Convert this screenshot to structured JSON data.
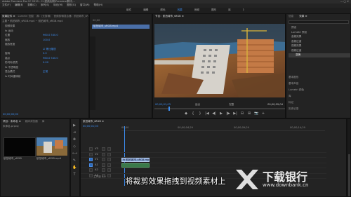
{
  "window": {
    "title": "Adobe Premiere Pro CC 2019 - C:\\视频后期\\Premiere素材\\...",
    "menu": [
      "文件(F)",
      "编辑(E)",
      "剪辑(C)",
      "序列(S)",
      "标记(M)",
      "图形(G)",
      "窗口(W)",
      "帮助(H)"
    ]
  },
  "workspace_tabs": [
    "组件",
    "编辑",
    "颜色",
    "效果",
    "音频",
    "图形",
    "库",
    "》"
  ],
  "effect_controls": {
    "tabs": [
      "效果控件 ≡",
      "Lumetri 范围",
      "源：(无剪辑)",
      "音频剪辑混合器：航拍城市_sRGB"
    ],
    "clip_path": "主要 * 航拍城市_sRGB.mp4 ~ 航拍城市_sRGB.mp4",
    "rows": [
      {
        "label": "视频效果",
        "value": ""
      },
      {
        "label": "fx 运动",
        "value": ""
      },
      {
        "label": "位置",
        "value": "960.0   540.0"
      },
      {
        "label": "缩放",
        "value": "100.0"
      },
      {
        "label": "缩放宽度",
        "value": ""
      },
      {
        "label": "",
        "value": "☑ 等比缩放"
      },
      {
        "label": "旋转",
        "value": "0.0"
      },
      {
        "label": "锚点",
        "value": "960.0   540.0"
      },
      {
        "label": "防闪烁滤镜",
        "value": "0.00"
      },
      {
        "label": "fx 不透明度",
        "value": ""
      },
      {
        "label": "混合模式",
        "value": "正常"
      },
      {
        "label": "fx 时间重映射",
        "value": ""
      }
    ],
    "timecode": "00;00;00;00"
  },
  "source_strip": {
    "ruler": "00;00",
    "clip_label": "航拍城市_sRGB.mp4"
  },
  "program_monitor": {
    "tab": "节目：航拍城市_sRGB ≡",
    "timecode_left": "00;00;01;03",
    "fit": "适合",
    "quality": "完整",
    "timecode_right": "00;00;09;04",
    "transport": [
      "◆",
      "{",
      "}",
      "|◀",
      "◀|",
      "▶",
      "|▶",
      "▶|",
      "⊟",
      "⊞",
      "📷",
      "+"
    ]
  },
  "effects_panel": {
    "tabs": [
      "信息",
      "效果 ≡"
    ],
    "search_placeholder": "",
    "items": [
      "预设",
      "Lumetri 预设",
      "音频效果",
      "音频过渡",
      "视频效果",
      "视频过渡"
    ],
    "selected_item": "变换",
    "sub_items": [
      "变换"
    ],
    "other_panels": [
      "基本图形",
      "基本声音",
      "Lumetri 颜色",
      "库",
      "标记",
      "历史记录"
    ]
  },
  "project_panel": {
    "tabs": [
      "项目：未命名 ≡",
      "媒体浏览器",
      "库"
    ],
    "title": "未命名.prproj",
    "clips": [
      {
        "name": "航拍城市_sRGB",
        "duration": "9;04"
      },
      {
        "name": "航拍城市_sRGB.mp4",
        "duration": "9;04"
      }
    ]
  },
  "timeline": {
    "tab": "航拍城市_sRGB ≡",
    "timecode": "00;00;01;03",
    "ruler": [
      "00;00",
      "00;00;04;29",
      "00;00;09;29",
      "00;00;14;29"
    ],
    "tracks": [
      {
        "name": "V3"
      },
      {
        "name": "V2"
      },
      {
        "name": "V1"
      },
      {
        "name": "A1"
      },
      {
        "name": "A2"
      },
      {
        "name": "A3"
      }
    ],
    "video_clip": "fx 航拍城市_sRGB.mp4",
    "master": "主声道  0.0"
  },
  "subtitle": "将裁剪效果拖拽到视频素材上",
  "watermark": {
    "title": "下载银行",
    "url": "www.downbank.cn"
  }
}
